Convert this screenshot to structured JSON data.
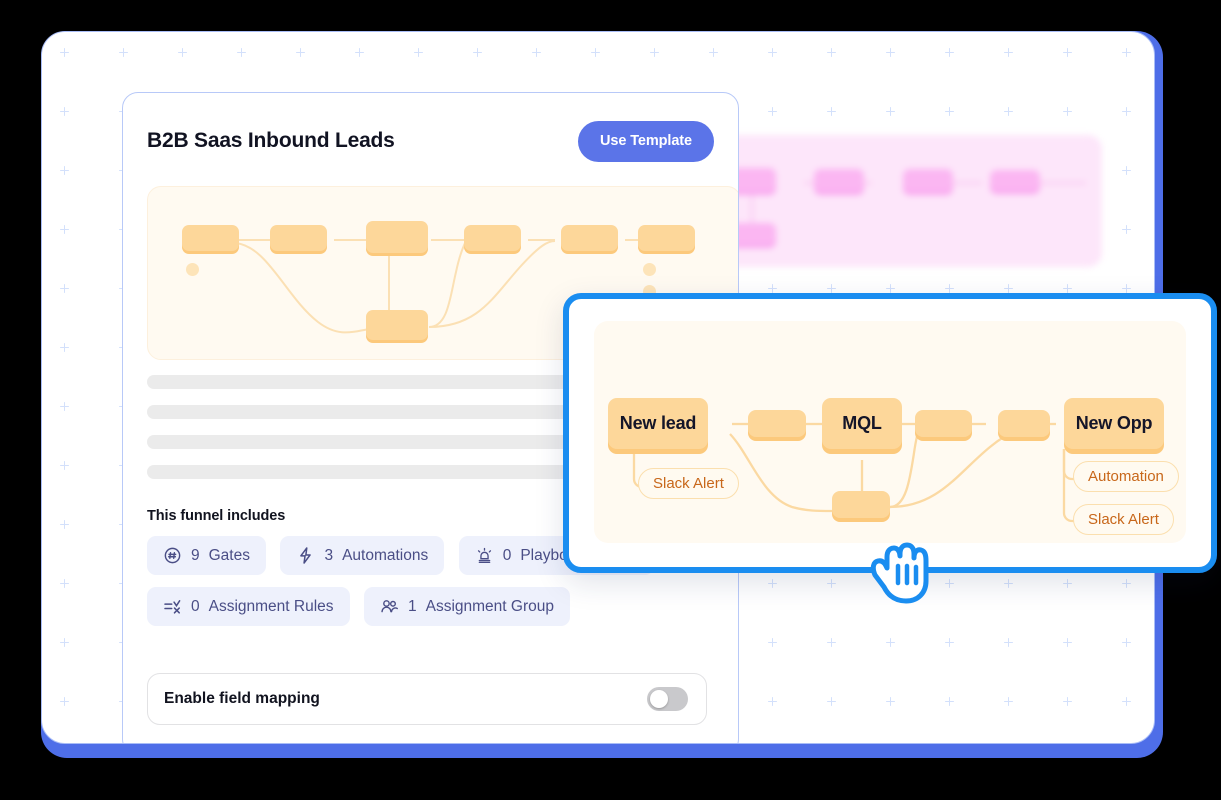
{
  "card": {
    "title": "B2B Saas Inbound Leads",
    "use_template_label": "Use Template",
    "section_label": "This funnel includes",
    "badges": [
      {
        "icon": "hash-circle-icon",
        "count": "9",
        "label": "Gates"
      },
      {
        "icon": "lightning-bolt-icon",
        "count": "3",
        "label": "Automations"
      },
      {
        "icon": "siren-icon",
        "count": "0",
        "label": "Playbook Actions"
      },
      {
        "icon": "rules-icon",
        "count": "0",
        "label": "Assignment Rules"
      },
      {
        "icon": "users-icon",
        "count": "1",
        "label": "Assignment Group"
      }
    ],
    "field_mapping": {
      "label": "Enable field mapping",
      "enabled": false
    }
  },
  "popup": {
    "nodes": [
      {
        "id": "new-lead",
        "label": "New lead"
      },
      {
        "id": "mql",
        "label": "MQL"
      },
      {
        "id": "new-opp",
        "label": "New Opp"
      }
    ],
    "pills": [
      {
        "id": "slack-alert-left",
        "label": "Slack Alert"
      },
      {
        "id": "automation-right",
        "label": "Automation"
      },
      {
        "id": "slack-alert-right",
        "label": "Slack Alert"
      }
    ],
    "cursor": "grab-hand-icon"
  },
  "colors": {
    "accent_blue": "#5b74e8",
    "popup_border": "#1a8df0",
    "node_orange": "#fdd79a",
    "node_orange_shadow": "#fcc97c",
    "canvas_cream": "#fffaf1",
    "badge_bg": "#eef1fc",
    "badge_text": "#4a4e86",
    "pill_text": "#c8671a",
    "pink_panel": "#fde6fa",
    "pink_node": "#fbb6f2",
    "skeleton": "#ebebeb",
    "toggle_off": "#c9c9cc"
  }
}
